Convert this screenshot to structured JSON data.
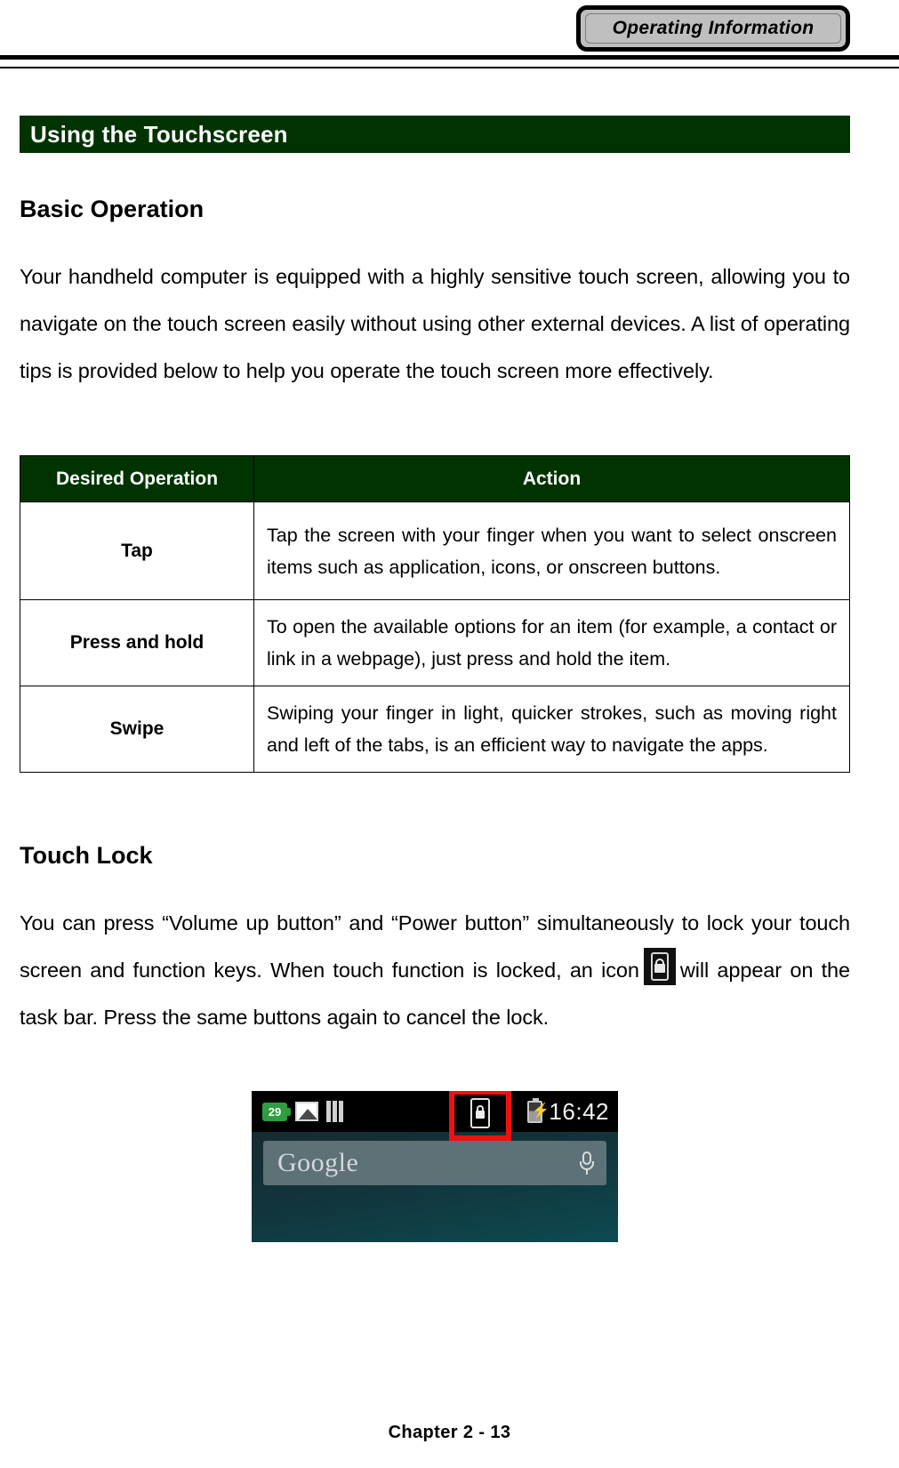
{
  "header": {
    "tab_label": "Operating Information"
  },
  "section": {
    "bar_title": "Using the Touchscreen"
  },
  "basic_operation": {
    "heading": "Basic Operation",
    "paragraph": "Your handheld computer is equipped with a highly sensitive touch screen, allowing you to navigate on the touch screen easily without using other external devices. A list of operating tips is provided below to help you operate the touch screen more effectively."
  },
  "ops_table": {
    "columns": [
      "Desired Operation",
      "Action"
    ],
    "rows": [
      {
        "operation": "Tap",
        "action": "Tap the screen with your finger when you want to select onscreen items such as application, icons, or onscreen buttons."
      },
      {
        "operation": "Press and hold",
        "action": "To open the available options for an item (for example, a contact or link in a webpage), just press and hold the item."
      },
      {
        "operation": "Swipe",
        "action": "Swiping your finger in light, quicker strokes, such as moving right and left of the tabs, is an efficient way to navigate the apps."
      }
    ]
  },
  "touch_lock": {
    "heading": "Touch Lock",
    "paragraph_part1": "You can press “Volume up button” and “Power button” simultaneously to lock your touch screen and function keys. When touch function is locked, an icon",
    "paragraph_part2": "will appear on the task bar. Press the same buttons again to cancel the lock.",
    "inline_icon": "touch-lock-icon"
  },
  "figure": {
    "status_bar": {
      "notification_count": "29",
      "icons": [
        "battery-notification-icon",
        "photo-icon",
        "bars-icon"
      ],
      "lock_icon": "touch-lock-icon",
      "battery_icon": "charging-battery-icon",
      "time": "16:42"
    },
    "search_widget": {
      "brand": "Google",
      "mic_icon": "microphone-icon"
    },
    "highlight_color": "#ee1111"
  },
  "footer": {
    "page_label": "Chapter 2 - 13"
  },
  "colors": {
    "section_green": "#003300",
    "header_tab_gray": "#bfbfbf",
    "highlight_red": "#ee1111"
  }
}
